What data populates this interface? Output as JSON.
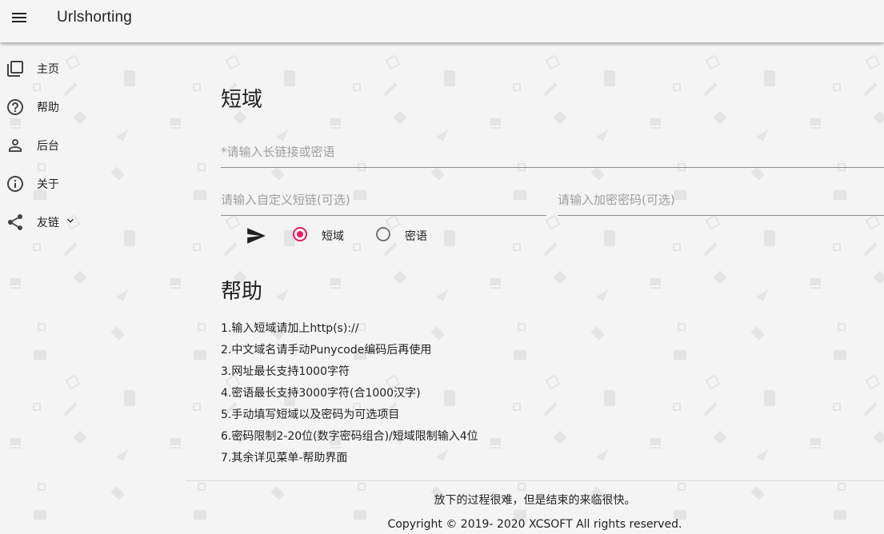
{
  "app": {
    "title": "Urlshorting"
  },
  "sidebar": {
    "items": [
      {
        "label": "主页",
        "icon": "library-icon"
      },
      {
        "label": "帮助",
        "icon": "help-icon"
      },
      {
        "label": "后台",
        "icon": "person-icon"
      },
      {
        "label": "关于",
        "icon": "info-icon"
      },
      {
        "label": "友链",
        "icon": "share-icon",
        "has_dropdown": true
      }
    ]
  },
  "main": {
    "shorten_heading": "短域",
    "url_placeholder": "*请输入长链接或密语",
    "custom_placeholder": "请输入自定义短链(可选)",
    "password_placeholder": "请输入加密密码(可选)",
    "mode_options": [
      {
        "label": "短域",
        "checked": true
      },
      {
        "label": "密语",
        "checked": false
      }
    ],
    "help_heading": "帮助",
    "help_items": [
      "1.输入短域请加上http(s)://",
      "2.中文域名请手动Punycode编码后再使用",
      "3.网址最长支持1000字符",
      "4.密语最长支持3000字符(合1000汉字)",
      "5.手动填写短域以及密码为可选项目",
      "6.密码限制2-20位(数字密码组合)/短域限制输入4位",
      "7.其余详见菜单-帮助界面"
    ]
  },
  "footer": {
    "quote": "放下的过程很难，但是结束的来临很快。",
    "copyright": "Copyright © 2019- 2020 XCSOFT All rights reserved."
  },
  "colors": {
    "accent": "#e91e63",
    "background": "#f4f4f4",
    "pattern": "#e4e4e4"
  }
}
